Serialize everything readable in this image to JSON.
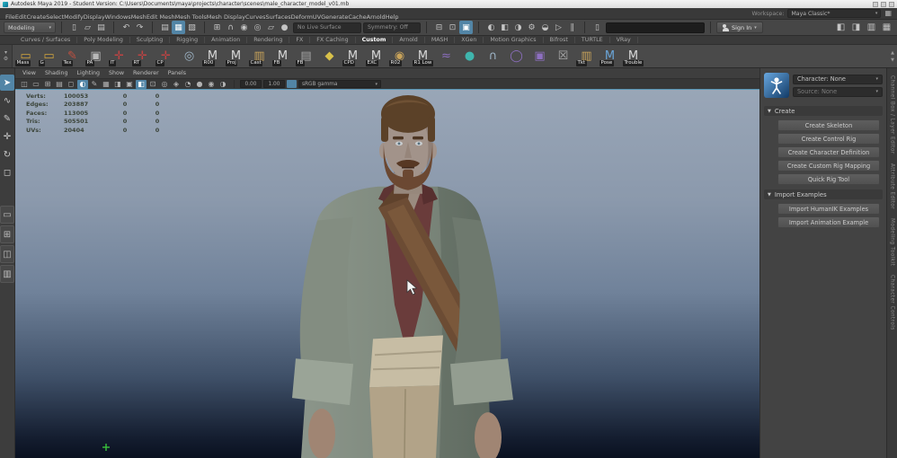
{
  "icons": {
    "chevron_down": "▾",
    "triangle_down": "▼",
    "scroll_up": "▲",
    "scroll_down": "▼",
    "shelf_menu": "▾",
    "gear": "⚙"
  },
  "window": {
    "title": "Autodesk Maya 2019 - Student Version: C:\\Users\\Documents\\maya\\projects\\character\\scenes\\male_character_model_v01.mb",
    "workspace_label": "Workspace:",
    "workspace_value": "Maya Classic*"
  },
  "menu_bar": {
    "items": [
      "File",
      "Edit",
      "Create",
      "Select",
      "Modify",
      "Display",
      "Windows",
      "Mesh",
      "Edit Mesh",
      "Mesh Tools",
      "Mesh Display",
      "Curves",
      "Surfaces",
      "Deform",
      "UV",
      "Generate",
      "Cache",
      "Arnold",
      "Help"
    ]
  },
  "status_line": {
    "menu_set": "Modeling",
    "file_icons": [
      {
        "name": "new-scene-icon",
        "glyph": "▯"
      },
      {
        "name": "open-scene-icon",
        "glyph": "▱"
      },
      {
        "name": "save-scene-icon",
        "glyph": "▤"
      }
    ],
    "undo_icons": [
      {
        "name": "undo-icon",
        "glyph": "↶"
      },
      {
        "name": "redo-icon",
        "glyph": "↷"
      }
    ],
    "selection_icons": [
      {
        "name": "hierarchy-mode-icon",
        "glyph": "▤"
      },
      {
        "name": "object-mode-icon",
        "glyph": "▦",
        "active": true
      },
      {
        "name": "component-mode-icon",
        "glyph": "▧"
      }
    ],
    "snap_icons": [
      {
        "name": "snap-to-grids-icon",
        "glyph": "⊞"
      },
      {
        "name": "snap-to-curves-icon",
        "glyph": "∩"
      },
      {
        "name": "snap-to-points-icon",
        "glyph": "◉"
      },
      {
        "name": "snap-to-projected-center-icon",
        "glyph": "◎"
      },
      {
        "name": "snap-to-view-planes-icon",
        "glyph": "▱"
      },
      {
        "name": "make-live-icon",
        "glyph": "●"
      }
    ],
    "live_surface_field": "No Live Surface",
    "symmetry_field": "Symmetry: Off",
    "history_icons": [
      {
        "name": "inputs-to-selected-icon",
        "glyph": "⊟"
      },
      {
        "name": "outputs-from-selected-icon",
        "glyph": "⊡"
      },
      {
        "name": "construction-history-icon",
        "glyph": "▣",
        "active": true
      }
    ],
    "render_icons": [
      {
        "name": "open-render-view-icon",
        "glyph": "◐"
      },
      {
        "name": "render-current-frame-icon",
        "glyph": "◧"
      },
      {
        "name": "ipr-render-icon",
        "glyph": "◑"
      },
      {
        "name": "render-settings-icon",
        "glyph": "⚙"
      },
      {
        "name": "hypershade-icon",
        "glyph": "◒"
      },
      {
        "name": "launch-application-icon",
        "glyph": "▷"
      },
      {
        "name": "pause-icon",
        "glyph": "∥"
      }
    ],
    "display_toggle": {
      "name": "panel-layout-toggle-icon",
      "glyph": "▯"
    },
    "sign_in_label": "Sign In",
    "sidebar_icons": [
      {
        "name": "modeling-toolkit-icon",
        "glyph": "◧"
      },
      {
        "name": "character-controls-icon",
        "glyph": "◨"
      },
      {
        "name": "attribute-editor-icon",
        "glyph": "▥"
      },
      {
        "name": "channel-box-icon",
        "glyph": "▦"
      }
    ]
  },
  "shelf": {
    "tabs": [
      {
        "label": "Curves / Surfaces"
      },
      {
        "label": "Poly Modeling"
      },
      {
        "label": "Sculpting"
      },
      {
        "label": "Rigging"
      },
      {
        "label": "Animation"
      },
      {
        "label": "Rendering"
      },
      {
        "label": "FX"
      },
      {
        "label": "FX Caching"
      },
      {
        "label": "Custom",
        "active": true
      },
      {
        "label": "Arnold"
      },
      {
        "label": "MASH"
      },
      {
        "label": "XGen"
      },
      {
        "label": "Motion Graphics"
      },
      {
        "label": "Bifrost"
      },
      {
        "label": "TURTLE"
      },
      {
        "label": "VRay"
      }
    ],
    "items": [
      {
        "glyph": "▭",
        "color": "#d2a63e",
        "label": "Mass"
      },
      {
        "glyph": "▭",
        "color": "#d2a63e",
        "label": "G"
      },
      {
        "glyph": "✎",
        "color": "#c05040",
        "label": "Tex"
      },
      {
        "glyph": "▣",
        "color": "#b8b8b8",
        "label": "PA"
      },
      {
        "glyph": "✛",
        "color": "#c04343",
        "label": "IT"
      },
      {
        "glyph": "✛",
        "color": "#c04343",
        "label": "RT"
      },
      {
        "glyph": "✛",
        "color": "#c04343",
        "label": "CP"
      },
      {
        "glyph": "◎",
        "color": "#9fb6c8",
        "label": ""
      },
      {
        "glyph": "M",
        "color": "#d8d8d8",
        "label": "R00"
      },
      {
        "glyph": "M",
        "color": "#d8d8d8",
        "label": "Proj"
      },
      {
        "glyph": "▥",
        "color": "#c8a35a",
        "label": "Cast"
      },
      {
        "glyph": "M",
        "color": "#d8d8d8",
        "label": "FB"
      },
      {
        "glyph": "▤",
        "color": "#a5a5a5",
        "label": "FB"
      },
      {
        "glyph": "◆",
        "color": "#d8c14a",
        "label": ""
      },
      {
        "glyph": "M",
        "color": "#d8d8d8",
        "label": "CPD"
      },
      {
        "glyph": "M",
        "color": "#d8d8d8",
        "label": "EXC"
      },
      {
        "glyph": "◉",
        "color": "#c8a35a",
        "label": "R02"
      },
      {
        "glyph": "M",
        "color": "#d8d8d8",
        "label": "R1 Low"
      },
      {
        "glyph": "≈",
        "color": "#8d6fc0",
        "label": ""
      },
      {
        "glyph": "●",
        "color": "#3fb5ad",
        "label": ""
      },
      {
        "glyph": "∩",
        "color": "#9fb6c8",
        "label": ""
      },
      {
        "glyph": "◯",
        "color": "#8d6fc0",
        "label": ""
      },
      {
        "glyph": "▣",
        "color": "#8d6fc0",
        "label": ""
      },
      {
        "glyph": "☒",
        "color": "#aaaaaa",
        "label": ""
      },
      {
        "glyph": "▥",
        "color": "#c8a35a",
        "label": "Tkt"
      },
      {
        "glyph": "M",
        "color": "#6aa5d8",
        "label": "Pose"
      },
      {
        "glyph": "M",
        "color": "#d8d8d8",
        "label": "Trouble"
      }
    ]
  },
  "panel": {
    "menus": [
      "View",
      "Shading",
      "Lighting",
      "Show",
      "Renderer",
      "Panels"
    ],
    "toolbar_icons": [
      {
        "name": "select-camera-icon",
        "glyph": "◫"
      },
      {
        "name": "lock-camera-icon",
        "glyph": "▭"
      },
      {
        "name": "camera-attributes-icon",
        "glyph": "⊞"
      },
      {
        "name": "bookmarks-icon",
        "glyph": "▤"
      },
      {
        "name": "image-plane-icon",
        "glyph": "◻"
      },
      {
        "name": "pan-zoom-icon",
        "glyph": "◐",
        "active": true
      },
      {
        "name": "grease-pencil-icon",
        "glyph": "✎"
      },
      {
        "name": "grid-icon",
        "glyph": "▦"
      },
      {
        "name": "film-gate-icon",
        "glyph": "◨"
      },
      {
        "name": "resolution-gate-icon",
        "glyph": "▣"
      },
      {
        "name": "gate-mask-icon",
        "glyph": "◧",
        "active": true
      },
      {
        "name": "field-chart-icon",
        "glyph": "⊡"
      },
      {
        "name": "safe-action-icon",
        "glyph": "◎"
      },
      {
        "name": "safe-title-icon",
        "glyph": "◈"
      },
      {
        "name": "wireframe-icon",
        "glyph": "◔"
      },
      {
        "name": "shaded-icon",
        "glyph": "●"
      },
      {
        "name": "textured-icon",
        "glyph": "◉"
      },
      {
        "name": "lights-icon",
        "glyph": "◑"
      }
    ],
    "exposure": "0.00",
    "gamma": "1.00",
    "view_transform": "sRGB gamma"
  },
  "hud": {
    "rows": [
      {
        "label": "Verts:",
        "total": "100053",
        "sel": "0",
        "anim": "0"
      },
      {
        "label": "Edges:",
        "total": "203887",
        "sel": "0",
        "anim": "0"
      },
      {
        "label": "Faces:",
        "total": "113005",
        "sel": "0",
        "anim": "0"
      },
      {
        "label": "Tris:",
        "total": "505501",
        "sel": "0",
        "anim": "0"
      },
      {
        "label": "UVs:",
        "total": "20404",
        "sel": "0",
        "anim": "0"
      }
    ]
  },
  "toolbox": {
    "tools": [
      {
        "name": "select-tool",
        "glyph": "➤",
        "active": true
      },
      {
        "name": "lasso-tool",
        "glyph": "∿"
      },
      {
        "name": "paint-selection-tool",
        "glyph": "✎"
      },
      {
        "name": "move-tool",
        "glyph": "✛"
      },
      {
        "name": "rotate-tool",
        "glyph": "↻"
      },
      {
        "name": "scale-tool",
        "glyph": "◻"
      }
    ],
    "layouts": [
      {
        "name": "single-view-layout",
        "glyph": "▭"
      },
      {
        "name": "four-view-layout",
        "glyph": "⊞"
      },
      {
        "name": "two-pane-layout",
        "glyph": "◫"
      },
      {
        "name": "outliner-layout",
        "glyph": "▥"
      }
    ]
  },
  "character_controls": {
    "character_dropdown": "Character: None",
    "source_dropdown": "Source: None",
    "sections": [
      {
        "title": "Create",
        "buttons": [
          "Create Skeleton",
          "Create Control Rig",
          "Create Character Definition",
          "Create Custom Rig Mapping",
          "Quick Rig Tool"
        ]
      },
      {
        "title": "Import Examples",
        "buttons": [
          "Import HumanIK Examples",
          "Import Animation Example"
        ]
      }
    ]
  },
  "side_tabs": [
    "Channel Box / Layer Editor",
    "Attribute Editor",
    "Modeling Toolkit",
    "Character Controls"
  ]
}
